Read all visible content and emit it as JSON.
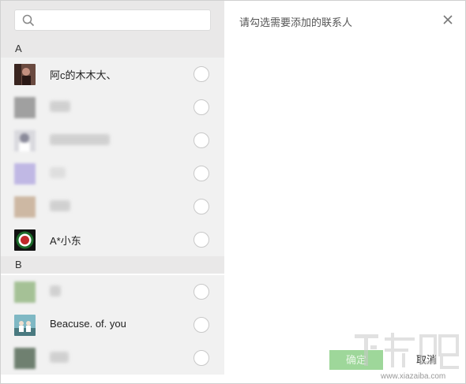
{
  "search": {
    "placeholder": "",
    "value": ""
  },
  "dialog": {
    "prompt": "请勾选需要添加的联系人",
    "confirm_label": "确定",
    "cancel_label": "取消"
  },
  "groups": [
    {
      "letter": "A",
      "contacts": [
        {
          "name": "阿c的木木大、",
          "blurred": false,
          "avatar_color": "#5a3a30",
          "selected": false
        },
        {
          "name": "",
          "blurred": true,
          "avatar_color": "#a0a0a0",
          "selected": false
        },
        {
          "name": "",
          "blurred": true,
          "avatar_color": "#c8c8d4",
          "selected": false
        },
        {
          "name": "",
          "blurred": true,
          "avatar_color": "#b9b3e0",
          "selected": false
        },
        {
          "name": "",
          "blurred": true,
          "avatar_color": "#d2b8a0",
          "selected": false
        },
        {
          "name": "A*小东",
          "blurred": false,
          "avatar_color": "#1c6b2a",
          "selected": false
        }
      ]
    },
    {
      "letter": "B",
      "contacts": [
        {
          "name": "",
          "blurred": true,
          "avatar_color": "#9fbf8f",
          "selected": false
        },
        {
          "name": "Beacuse. of. you",
          "blurred": false,
          "avatar_color": "#5aa0b0",
          "selected": false
        },
        {
          "name": "",
          "blurred": true,
          "avatar_color": "#7a8a78",
          "selected": false
        }
      ]
    }
  ],
  "watermark": {
    "text": "下载吧",
    "sub": "www.xiazaiba.com"
  },
  "colors": {
    "accent": "#9ed79a",
    "panel_bg": "#f1f1f1",
    "header_bg": "#e9e8e8"
  }
}
